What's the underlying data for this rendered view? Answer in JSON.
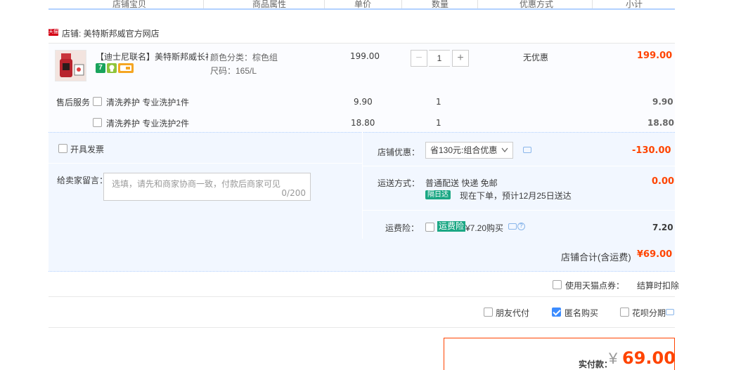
{
  "header": {
    "col_item": "店铺宝贝",
    "col_attr": "商品属性",
    "col_price": "单价",
    "col_qty": "数量",
    "col_discount": "优惠方式",
    "col_subtotal": "小计"
  },
  "shop": {
    "badge": "天猫",
    "name": "店铺: 美特斯邦威官方网店"
  },
  "item": {
    "title": "【迪士尼联名】美特斯邦威长袖...",
    "color_label": "颜色分类：棕色组",
    "size_label": "尺码：165/L",
    "price": "199.00",
    "qty": "1",
    "qty_minus": "−",
    "qty_plus": "+",
    "discount": "无优惠",
    "subtotal": "199.00",
    "badge_num": "7"
  },
  "services": {
    "label": "售后服务",
    "rows": [
      {
        "name": "清洗养护 专业洗护1件",
        "price": "9.90",
        "qty": "1",
        "subtotal": "9.90"
      },
      {
        "name": "清洗养护 专业洗护2件",
        "price": "18.80",
        "qty": "1",
        "subtotal": "18.80"
      }
    ]
  },
  "options": {
    "invoice_label": "开具发票",
    "message_label": "给卖家留言：",
    "message_placeholder": "选填，请先和商家协商一致，付款后商家可见",
    "message_count": "0/200",
    "shop_discount_label": "店铺优惠：",
    "shop_discount_value": "省130元:组合优惠",
    "shop_discount_amount": "-130.00",
    "shipping_label": "运送方式：",
    "shipping_value": "普通配送 快递 免邮",
    "next_day_badge": "隔日达",
    "shipping_eta": "现在下单，预计12月25日送达",
    "shipping_amount": "0.00",
    "insurance_label": "运费险：",
    "insurance_badge": "运费险",
    "insurance_price": "¥7.20购买",
    "insurance_amount": "7.20"
  },
  "shop_total": {
    "label": "店铺合计(含运费)",
    "value": "¥69.00"
  },
  "tmall_points": {
    "label": "使用天猫点券：",
    "note": "结算时扣除"
  },
  "pay_options": {
    "friend_pay": "朋友代付",
    "anonymous": "匿名购买",
    "huabei": "花呗分期"
  },
  "payment": {
    "label": "实付款：",
    "currency": "¥",
    "amount": "69.00"
  },
  "colors": {
    "accent_red": "#ff4400",
    "link_blue": "#3c8cff",
    "panel_blue": "#f2f7ff",
    "green": "#1ba784"
  }
}
